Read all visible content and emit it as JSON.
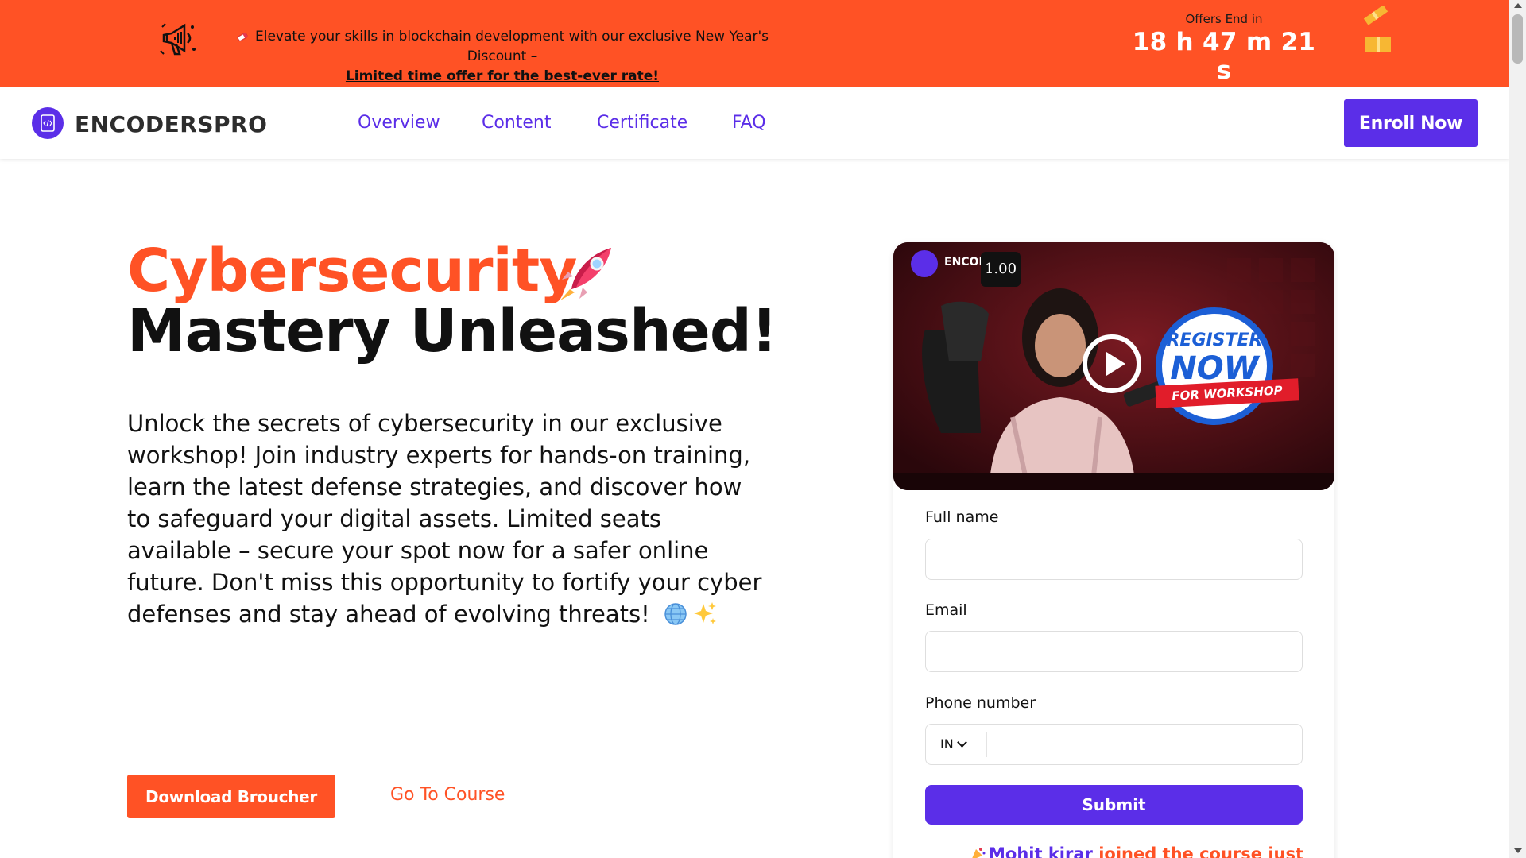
{
  "colors": {
    "accent_orange": "#ff5225",
    "brand_purple": "#5b2ee8",
    "promo_bg": "#ff5225"
  },
  "promo": {
    "message": "Elevate your skills in blockchain development with our exclusive New Year's Discount –",
    "link": "Limited time offer for the best-ever rate!",
    "offers_label": "Offers End in",
    "countdown": "18 h 47 m 21 s",
    "icons": [
      "megaphone-icon",
      "pen-icon",
      "gift-icon"
    ]
  },
  "nav": {
    "brand": "ENCODERSPRO",
    "links": [
      "Overview",
      "Content",
      "Certificate",
      "FAQ"
    ],
    "enroll_label": "Enroll Now"
  },
  "hero": {
    "title_line1": "Cybersecurity",
    "title_line2": "Mastery Unleashed!",
    "description": "Unlock the secrets of cybersecurity in our exclusive workshop! Join industry experts for hands-on training, learn the latest defense strategies, and discover how to safeguard your digital assets. Limited seats available – secure your spot now for a safer online future. Don't miss this opportunity to fortify your cyber defenses and stay ahead of evolving threats!",
    "download_label": "Download Broucher",
    "goto_label": "Go To Course"
  },
  "video": {
    "brand": "ENCOD",
    "speed": "1.00",
    "register_line1": "REGISTER",
    "register_line2": "NOW",
    "register_line3": "FOR WORKSHOP"
  },
  "form": {
    "full_name_label": "Full name",
    "full_name_value": "",
    "email_label": "Email",
    "email_value": "",
    "phone_label": "Phone number",
    "country_code": "IN",
    "phone_value": "",
    "submit_label": "Submit",
    "joined_name": "Mohit kirar",
    "joined_text": "joined the course just"
  }
}
